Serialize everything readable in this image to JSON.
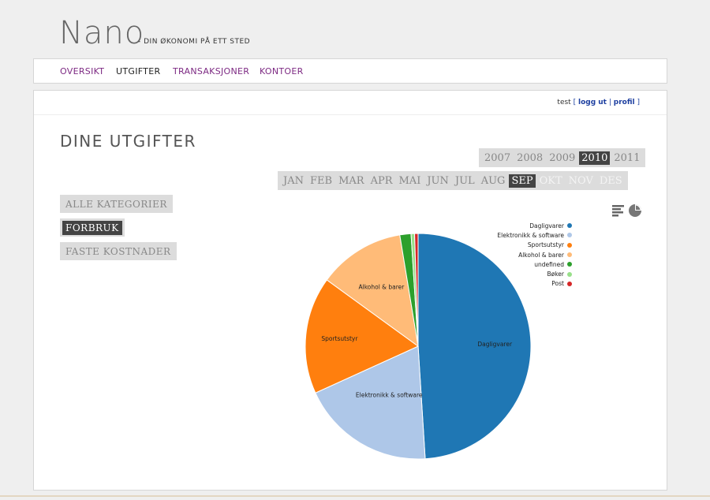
{
  "header": {
    "logo": "Nano",
    "tagline": "- DIN ØKONOMI PÅ ETT STED"
  },
  "nav": {
    "items": [
      "OVERSIKT",
      "UTGIFTER",
      "TRANSAKSJONER",
      "KONTOER"
    ],
    "active": "UTGIFTER"
  },
  "userbar": {
    "user": "test",
    "logout": "logg ut",
    "profile": "profil"
  },
  "page": {
    "title": "DINE UTGIFTER"
  },
  "years": {
    "items": [
      "2007",
      "2008",
      "2009",
      "2010",
      "2011"
    ],
    "selected": "2010"
  },
  "months": {
    "items": [
      "JAN",
      "FEB",
      "MAR",
      "APR",
      "MAI",
      "JUN",
      "JUL",
      "AUG",
      "SEP",
      "OKT",
      "NOV",
      "DES"
    ],
    "selected": "SEP",
    "disabled": [
      "OKT",
      "NOV",
      "DES"
    ]
  },
  "categories": {
    "items": [
      "ALLE KATEGORIER",
      "FORBRUK",
      "FASTE KOSTNADER"
    ],
    "selected": "FORBRUK"
  },
  "view_icons": [
    "bar-chart-icon",
    "pie-chart-icon"
  ],
  "chart_data": {
    "type": "pie",
    "labels": [
      "Dagligvarer",
      "Elektronikk & software",
      "Sportsutstyr",
      "Alkohol & barer",
      "undefined",
      "Bøker",
      "Post"
    ],
    "values": [
      49.0,
      19.2,
      16.8,
      12.4,
      1.6,
      0.5,
      0.5
    ],
    "colors": [
      "#1f77b4",
      "#aec7e8",
      "#ff7f0e",
      "#ffbb78",
      "#2ca02c",
      "#98df8a",
      "#d62728"
    ],
    "legend_position": "top-right"
  }
}
